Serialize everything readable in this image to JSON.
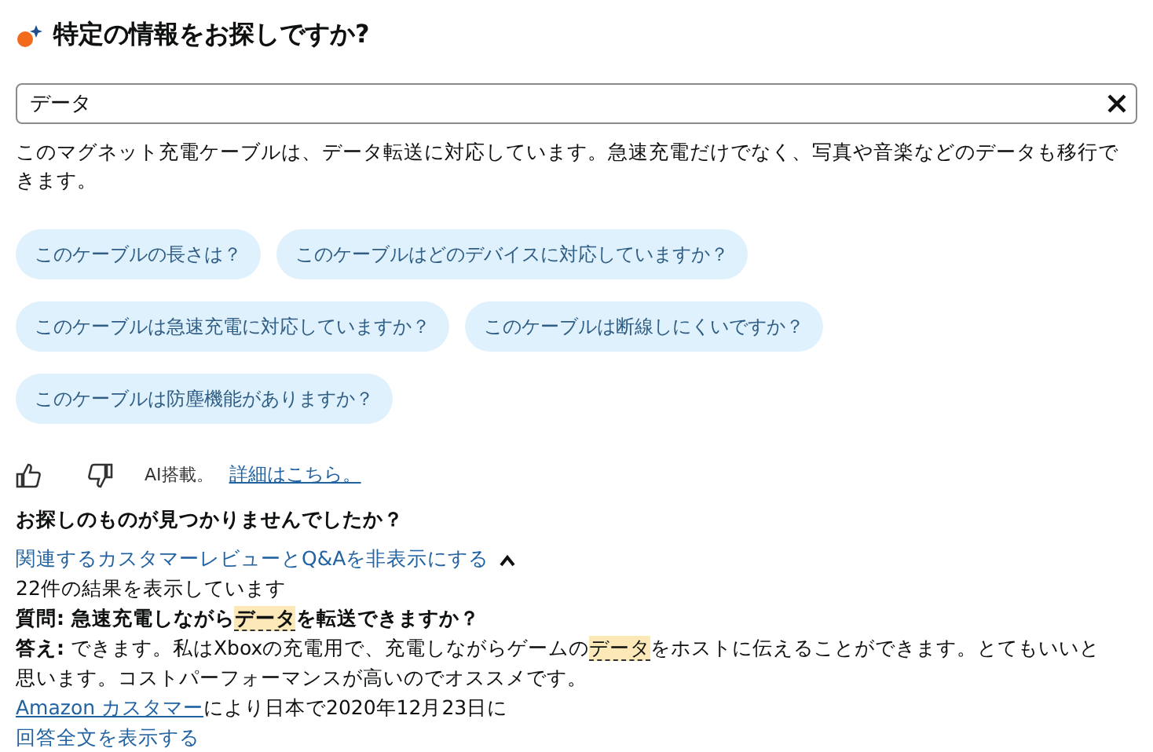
{
  "heading": "特定の情報をお探しですか?",
  "search": {
    "value": "データ"
  },
  "answer": "このマグネット充電ケーブルは、データ転送に対応しています。急速充電だけでなく、写真や音楽などのデータも移行できます。",
  "suggestions": [
    "このケーブルの長さは？",
    "このケーブルはどのデバイスに対応していますか？",
    "このケーブルは急速充電に対応していますか？",
    "このケーブルは断線しにくいですか？",
    "このケーブルは防塵機能がありますか？"
  ],
  "feedback": {
    "ai_note": "AI搭載。",
    "link": "詳細はこちら。"
  },
  "not_found": "お探しのものが見つかりませんでしたか？",
  "related": {
    "toggle": "関連するカスタマーレビューとQ&Aを非表示にする",
    "expanded": true,
    "count": "22件の結果を表示しています",
    "question": {
      "label": "質問:",
      "before": "急速充電しながら",
      "highlight": "データ",
      "after": "を転送できますか？"
    },
    "reply": {
      "label": "答え:",
      "before": "できます。私はXboxの充電用で、充電しながらゲームの",
      "highlight": "データ",
      "after": "をホストに伝えることができます。とてもいいと思います。コストパーフォーマンスが高いのでオススメです。"
    },
    "author_link": "Amazon カスタマー",
    "author_rest": "により日本で2020年12月23日に",
    "show_full": "回答全文を表示する"
  }
}
